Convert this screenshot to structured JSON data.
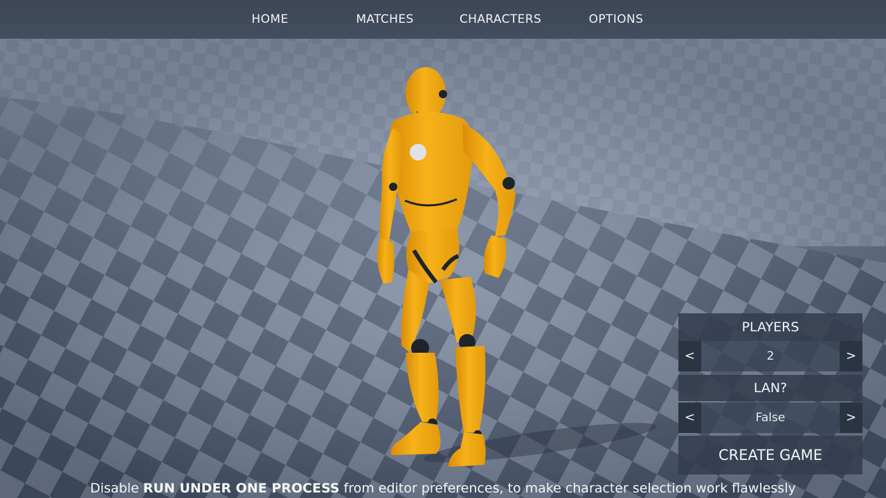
{
  "nav": {
    "items": [
      {
        "id": "home",
        "label": "HOME"
      },
      {
        "id": "matches",
        "label": "MATCHES"
      },
      {
        "id": "characters",
        "label": "CHARACTERS"
      },
      {
        "id": "options",
        "label": "OPTIONS"
      }
    ]
  },
  "panel": {
    "players": {
      "label": "PLAYERS",
      "value": "2",
      "prev": "<",
      "next": ">"
    },
    "lan": {
      "label": "LAN?",
      "value": "False",
      "prev": "<",
      "next": ">"
    },
    "create_game_label": "CREATE GAME"
  },
  "hint": {
    "prefix": "Disable ",
    "emphasis": "RUN UNDER ONE PROCESS",
    "suffix": " from editor preferences, to make character selection work flawlessly"
  },
  "colors": {
    "character": "#f5a913",
    "character_shadow": "#c9800a",
    "joint": "#1f242b",
    "floor_dark": "#3f4b5e",
    "floor_light": "#7b889d"
  },
  "icons": {
    "chest_emblem": "circle-emblem-icon"
  }
}
